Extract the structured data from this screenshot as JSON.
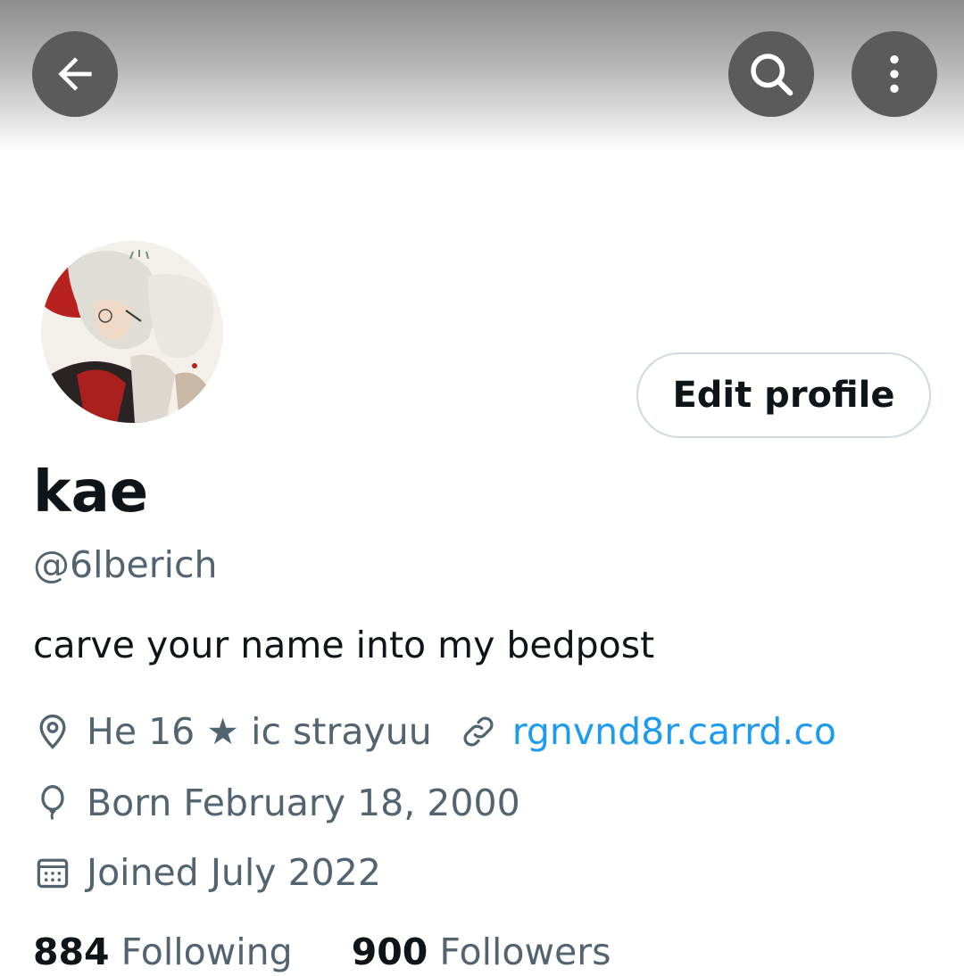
{
  "header": {
    "back_icon": "arrow-left-icon",
    "search_icon": "search-icon",
    "more_icon": "more-vertical-icon"
  },
  "profile": {
    "display_name": "kae",
    "handle": "@6lberich",
    "bio": "carve your name into my bedpost",
    "edit_label": "Edit profile",
    "location": "He 16 ★ ic strayuu",
    "website": "rgnvnd8r.carrd.co",
    "birthday": "Born February 18, 2000",
    "joined": "Joined July 2022"
  },
  "stats": {
    "following_count": "884",
    "following_label": "Following",
    "followers_count": "900",
    "followers_label": "Followers"
  },
  "colors": {
    "text_primary": "#0f1419",
    "text_secondary": "#536471",
    "link": "#1d9bf0",
    "button_border": "#cfd9de",
    "header_button": "#5b5b5b"
  }
}
